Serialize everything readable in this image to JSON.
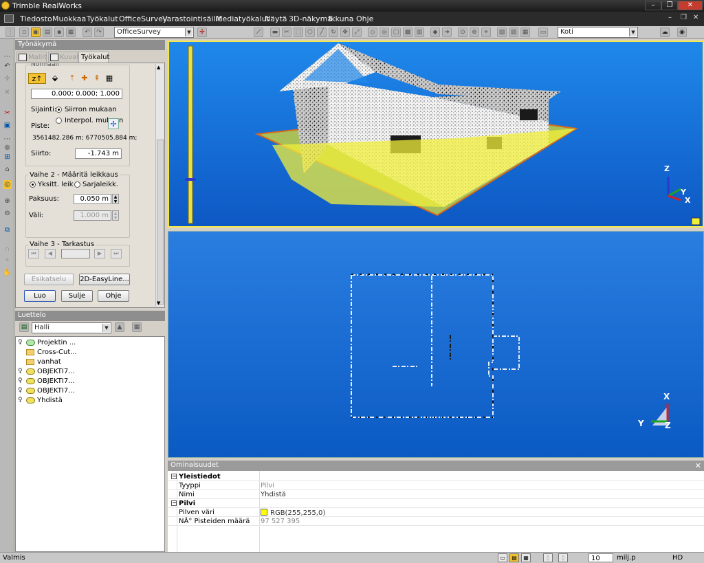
{
  "app": {
    "title": "Trimble RealWorks"
  },
  "window_controls": {
    "minimize": "–",
    "restore": "❐",
    "close": "✕",
    "doc_minimize": "–",
    "doc_restore": "❐",
    "doc_close": "✕"
  },
  "menu": [
    "Tiedosto",
    "Muokkaa",
    "Työkalut",
    "OfficeSurvey",
    "Varastointisäiliö",
    "Mediatyökalut",
    "Näytä",
    "3D-näkymä",
    "Ikkuna",
    "Ohje"
  ],
  "toolbar": {
    "mode_combo": "OfficeSurvey",
    "view_combo": "Koti"
  },
  "workview": {
    "title": "Työnäkymä",
    "tabs": [
      "Mallit",
      "Kuvat",
      "Työkalut"
    ],
    "step1": {
      "heading": "Normaali",
      "normal_value": "0.000; 0.000; 1.000",
      "location_label": "Sijainti:",
      "radio1": "Siirron mukaan",
      "radio2": "Interpol. mukaan",
      "point_label": "Piste:",
      "point_value": "3561482.286 m; 6770505.884 m;",
      "offset_label": "Siirto:",
      "offset_value": "-1.743 m"
    },
    "step2": {
      "heading": "Vaihe 2 - Määritä leikkaus",
      "radio1": "Yksitt. leikkaus",
      "radio2": "Sarjaleikk.",
      "thickness_label": "Paksuus:",
      "thickness_value": "0.050 m",
      "gap_label": "Väli:",
      "gap_value": "1.000 m"
    },
    "step3": {
      "heading": "Vaihe 3 - Tarkastus"
    },
    "buttons": {
      "preview": "Esikatselu",
      "easyline": "2D-EasyLine...",
      "create": "Luo",
      "close": "Sulje",
      "help": "Ohje"
    }
  },
  "catalog": {
    "title": "Luettelo",
    "combo": "Halli",
    "items": [
      "Projektin ...",
      "Cross-Cut...",
      "vanhat",
      "OBJEKTI7...",
      "OBJEKTI7...",
      "OBJEKTI7...",
      "Yhdistä"
    ]
  },
  "viewport_top": {
    "axes": {
      "z": "Z",
      "y": "Y",
      "x": "X"
    }
  },
  "viewport_bottom": {
    "axes": {
      "x": "X",
      "y": "Y",
      "z": "Z"
    }
  },
  "properties": {
    "title": "Ominaisuudet",
    "section1": "Yleistiedot",
    "type_label": "Tyyppi",
    "type_value": "Pilvi",
    "name_label": "Nimi",
    "name_value": "Yhdistä",
    "section2": "Pilvi",
    "color_label": "Pilven väri",
    "color_value": "RGB(255,255,0)",
    "count_label": "NÂ° Pisteiden määrä",
    "count_value": "97 527 395"
  },
  "colors": {
    "cloud": "#ffff00",
    "viewport_bg": "#1a73d9",
    "accent": "#f2c232"
  },
  "icons": [
    "magnet-icon",
    "zoom-in-icon",
    "zoom-out-icon",
    "lock-icon",
    "bulb-icon",
    "folder-icon",
    "cloud-icon"
  ],
  "status": {
    "ready": "Valmis",
    "count": "10",
    "unit": "milj.p",
    "quality": "HD"
  }
}
